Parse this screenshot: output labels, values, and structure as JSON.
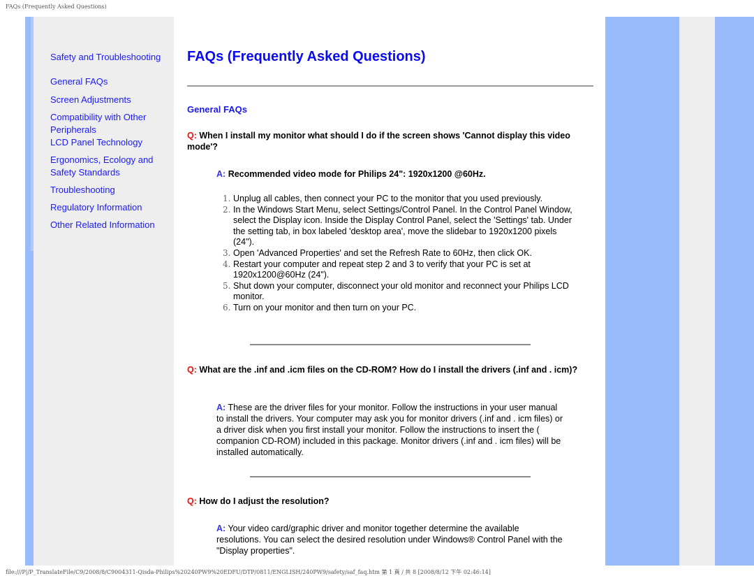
{
  "header": {
    "title": "FAQs (Frequently Asked Questions)"
  },
  "sidebar": {
    "items": [
      {
        "label": "Safety and Troubleshooting"
      },
      {
        "label": "General FAQs"
      },
      {
        "label": "Screen Adjustments"
      },
      {
        "label": "Compatibility with Other Peripherals"
      },
      {
        "label": "LCD Panel Technology"
      },
      {
        "label": "Ergonomics, Ecology and Safety Standards"
      },
      {
        "label": "Troubleshooting"
      },
      {
        "label": "Regulatory Information"
      },
      {
        "label": "Other Related Information"
      }
    ]
  },
  "main": {
    "title": "FAQs (Frequently Asked Questions)",
    "section": "General FAQs",
    "q_label": "Q:",
    "a_label": "A:",
    "faqs": [
      {
        "question": "When I install my monitor what should I do if the screen shows 'Cannot display this video mode'?",
        "answer": "Recommended video mode for Philips 24\": 1920x1200 @60Hz.",
        "steps": [
          {
            "num": "1.",
            "text": "Unplug all cables, then connect your PC to the monitor that you used previously."
          },
          {
            "num": "2.",
            "text": "In the Windows Start Menu, select Settings/Control Panel. In the Control Panel Window, select the Display icon. Inside the Display Control Panel, select the 'Settings' tab. Under the setting tab, in box labeled 'desktop area', move the slidebar to 1920x1200 pixels (24\")."
          },
          {
            "num": "3.",
            "text": "Open 'Advanced Properties' and set the Refresh Rate to 60Hz, then click OK."
          },
          {
            "num": "4.",
            "text": "Restart your computer and repeat step 2 and 3 to verify that your PC is set at 1920x1200@60Hz (24\")."
          },
          {
            "num": "5.",
            "text": "Shut down your computer, disconnect your old monitor and reconnect your Philips LCD monitor."
          },
          {
            "num": "6.",
            "text": "Turn on your monitor and then turn on your PC."
          }
        ]
      },
      {
        "question": "What are the .inf and .icm files on the CD-ROM? How do I install the drivers (.inf and . icm)?",
        "answer": "These are the driver files for your monitor. Follow the instructions in your user manual to install the drivers. Your computer may ask you for monitor drivers (.inf and . icm files) or a driver disk when you first install your monitor. Follow the instructions to insert the ( companion CD-ROM) included in this package. Monitor drivers (.inf and . icm files) will be installed automatically."
      },
      {
        "question": "How do I adjust the resolution?",
        "answer": "Your video card/graphic driver and monitor together determine the available resolutions. You can select the desired resolution under Windows® Control Panel with the \"Display properties\"."
      }
    ]
  },
  "footer": {
    "text": "file:///P|/P_TranslateFile/C9/2008/8/C9004311-Qisda-Philips%20240PW9%20EDFU/DTP/0811/ENGLISH/240PW9/safety/saf_faq.htm 第 1 頁 / 共 8 [2008/8/12 下午 02:46:14]"
  },
  "colors": {
    "link": "#1a1aff",
    "title": "#0a0aee",
    "q_label": "#ee1111",
    "a_label": "#3333ee",
    "panel_blue": "#99bbfa",
    "panel_gray": "#eeeeee"
  }
}
